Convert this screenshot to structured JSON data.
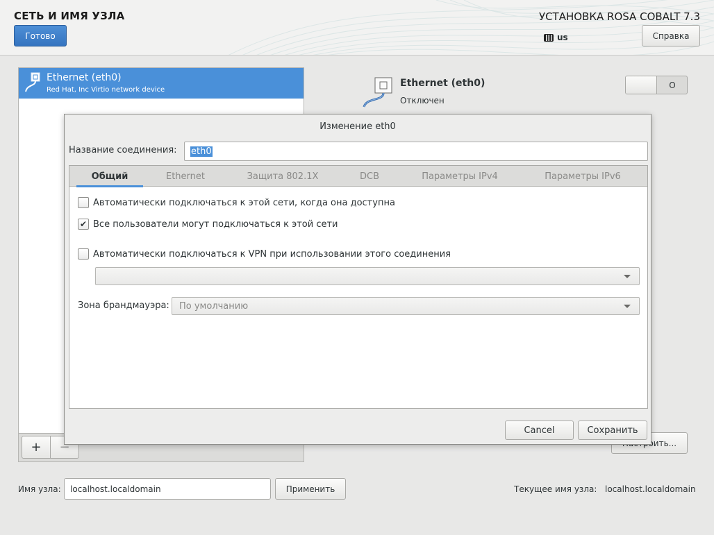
{
  "header": {
    "title": "СЕТЬ И ИМЯ УЗЛА",
    "done_label": "Готово",
    "install_title": "УСТАНОВКА ROSA COBALT 7.3",
    "keyboard_layout": "us",
    "help_label": "Справка"
  },
  "devices": [
    {
      "name": "Ethernet (eth0)",
      "description": "Red Hat, Inc Virtio network device",
      "icon": "network-cable-icon"
    }
  ],
  "list_controls": {
    "add_label": "+",
    "remove_label": "−"
  },
  "device_detail": {
    "name": "Ethernet (eth0)",
    "status": "Отключен",
    "toggle_label": "O",
    "configure_label": "Настроить..."
  },
  "hostname": {
    "label": "Имя узла:",
    "value": "localhost.localdomain",
    "apply_label": "Применить",
    "current_label": "Текущее имя узла:",
    "current_value": "localhost.localdomain"
  },
  "dialog": {
    "title": "Изменение eth0",
    "connection_name_label": "Название соединения:",
    "connection_name_value": "eth0",
    "tabs": [
      "Общий",
      "Ethernet",
      "Защита 802.1X",
      "DCB",
      "Параметры IPv4",
      "Параметры IPv6"
    ],
    "active_tab": "Общий",
    "general": {
      "auto_connect": {
        "label": "Автоматически подключаться к этой сети, когда она доступна",
        "checked": false
      },
      "all_users": {
        "label": "Все пользователи могут подключаться к этой сети",
        "checked": true
      },
      "auto_vpn": {
        "label": "Автоматически подключаться к VPN при использовании этого соединения",
        "checked": false
      },
      "vpn_select_value": "",
      "firewall_label": "Зона брандмауэра:",
      "firewall_value": "По умолчанию"
    },
    "cancel_label": "Cancel",
    "save_label": "Сохранить"
  },
  "colors": {
    "accent": "#4a90d9",
    "selection": "#4a90d9"
  }
}
